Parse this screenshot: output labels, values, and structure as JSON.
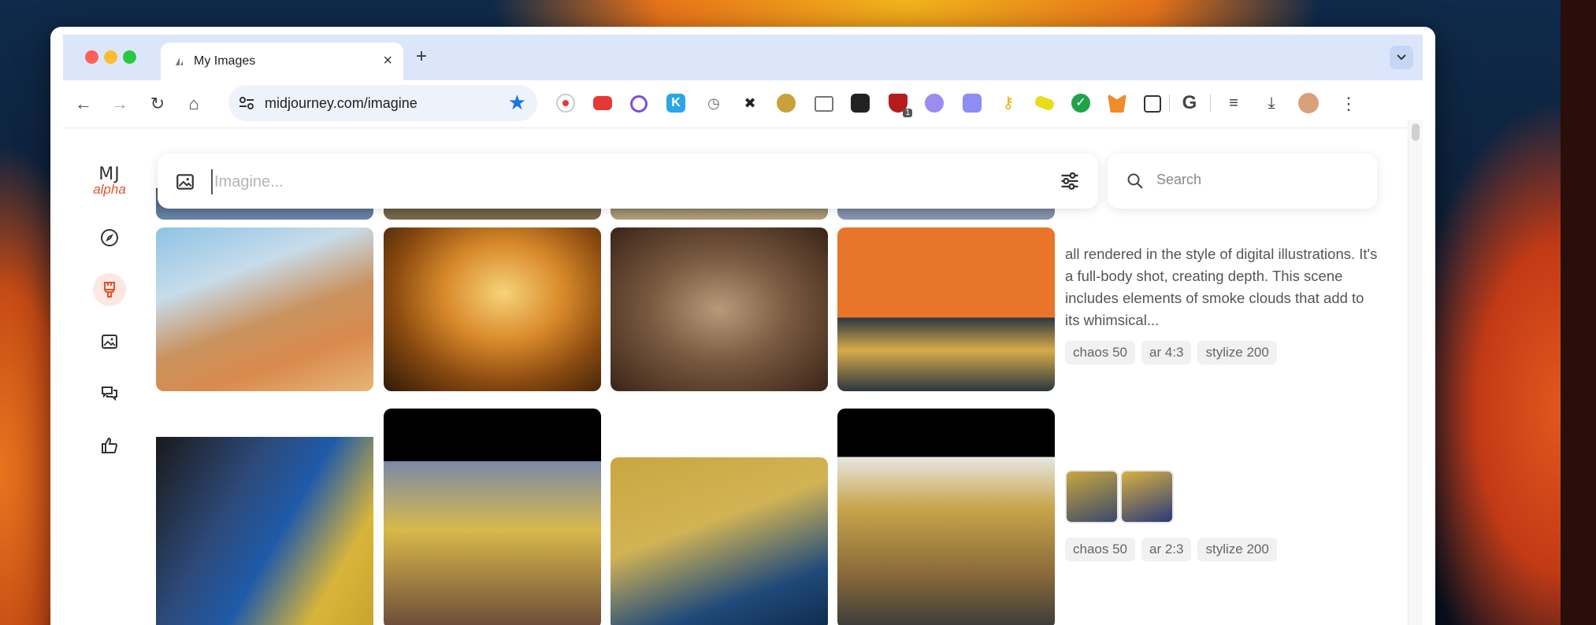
{
  "browser": {
    "tab_title": "My Images",
    "tab_close": "×",
    "new_tab": "+",
    "tab_menu": "⌄",
    "url": "midjourney.com/imagine",
    "nav": {
      "back": "←",
      "forward": "→",
      "reload": "↻",
      "home": "⌂",
      "menu": "⋮"
    },
    "extensions": [
      "record-icon",
      "youtube-icon",
      "link-icon",
      "k-extension-icon",
      "history-icon",
      "pin-icon",
      "owl-icon",
      "screen-icon",
      "panda-icon",
      "shield-icon",
      "ai-assistant-icon",
      "box-icon",
      "key-icon",
      "marker-icon",
      "check-icon",
      "fox-icon",
      "puzzle-icon",
      "google-icon",
      "playlist-icon",
      "download-icon",
      "profile-avatar"
    ],
    "shield_badge": "1",
    "google_letter": "G"
  },
  "sidebar": {
    "logo_mj": "MJ",
    "logo_alpha": "alpha",
    "items": [
      "explore-icon",
      "create-icon",
      "images-icon",
      "chat-icon",
      "likes-icon"
    ],
    "active": "create-icon"
  },
  "prompt": {
    "placeholder": "Imagine..."
  },
  "search": {
    "placeholder": "Search"
  },
  "details": [
    {
      "description": "all rendered in the style of digital illustrations. It's a full-body shot, creating depth. This scene includes elements of smoke clouds that add to its whimsical...",
      "params": [
        "chaos 50",
        "ar 4:3",
        "stylize 200"
      ]
    },
    {
      "description": "",
      "params": [
        "chaos 50",
        "ar 2:3",
        "stylize 200"
      ]
    }
  ],
  "colors": {
    "accent": "#e0532b",
    "accent_bg": "#fde7e2",
    "star": "#1a73e8",
    "tab_bg": "#dbe6fb"
  }
}
